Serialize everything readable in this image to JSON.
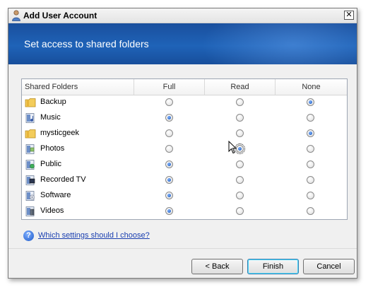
{
  "window": {
    "title": "Add User Account",
    "close_label": "✕"
  },
  "banner": {
    "title": "Set access to shared folders"
  },
  "table": {
    "headers": [
      "Shared Folders",
      "Full",
      "Read",
      "None"
    ],
    "rows": [
      {
        "name": "Backup",
        "icon": "folder-icon",
        "selected": "None"
      },
      {
        "name": "Music",
        "icon": "music-folder-icon",
        "selected": "Full"
      },
      {
        "name": "mysticgeek",
        "icon": "folder-icon",
        "selected": "None"
      },
      {
        "name": "Photos",
        "icon": "pictures-folder-icon",
        "selected": "Read"
      },
      {
        "name": "Public",
        "icon": "public-folder-icon",
        "selected": "Full"
      },
      {
        "name": "Recorded TV",
        "icon": "tv-folder-icon",
        "selected": "Full"
      },
      {
        "name": "Software",
        "icon": "software-folder-icon",
        "selected": "Full"
      },
      {
        "name": "Videos",
        "icon": "videos-folder-icon",
        "selected": "Full"
      }
    ]
  },
  "help": {
    "link_text": "Which settings should I choose?"
  },
  "buttons": {
    "back": "< Back",
    "finish": "Finish",
    "cancel": "Cancel"
  },
  "colors": {
    "banner": "#1f63b8",
    "link": "#1a3fb0",
    "radio_checked": "#0f4fb4"
  }
}
